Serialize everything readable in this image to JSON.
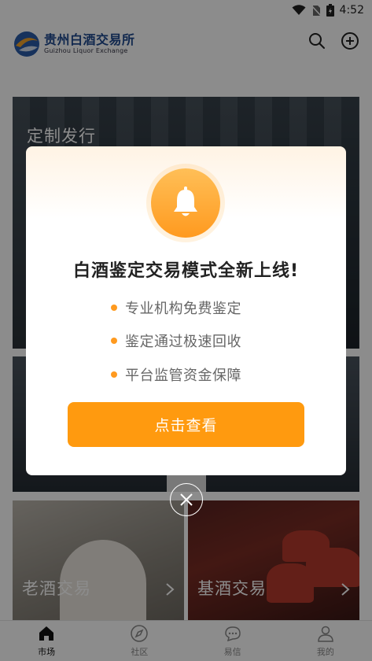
{
  "status": {
    "time": "4:52"
  },
  "header": {
    "logo_cn": "贵州白酒交易所",
    "logo_en": "Guizhou Liquor Exchange",
    "icons": [
      "search-icon",
      "add-circle-icon"
    ]
  },
  "cards": {
    "custom_title": "定制发行",
    "old_label": "老酒交易",
    "base_label": "基酒交易"
  },
  "tabbar": {
    "items": [
      {
        "label": "市场",
        "icon": "home-icon"
      },
      {
        "label": "社区",
        "icon": "compass-icon"
      },
      {
        "label": "易信",
        "icon": "chat-icon"
      },
      {
        "label": "我的",
        "icon": "user-icon"
      }
    ]
  },
  "modal": {
    "icon": "bell-icon",
    "title": "白酒鉴定交易模式全新上线!",
    "features": [
      "专业机构免费鉴定",
      "鉴定通过极速回收",
      "平台监管资金保障"
    ],
    "cta_label": "点击查看",
    "close_icon": "close-icon"
  },
  "colors": {
    "accent": "#ff9a0f",
    "brand": "#1f4a8f",
    "overlay": "rgba(0,0,0,0.45)"
  }
}
